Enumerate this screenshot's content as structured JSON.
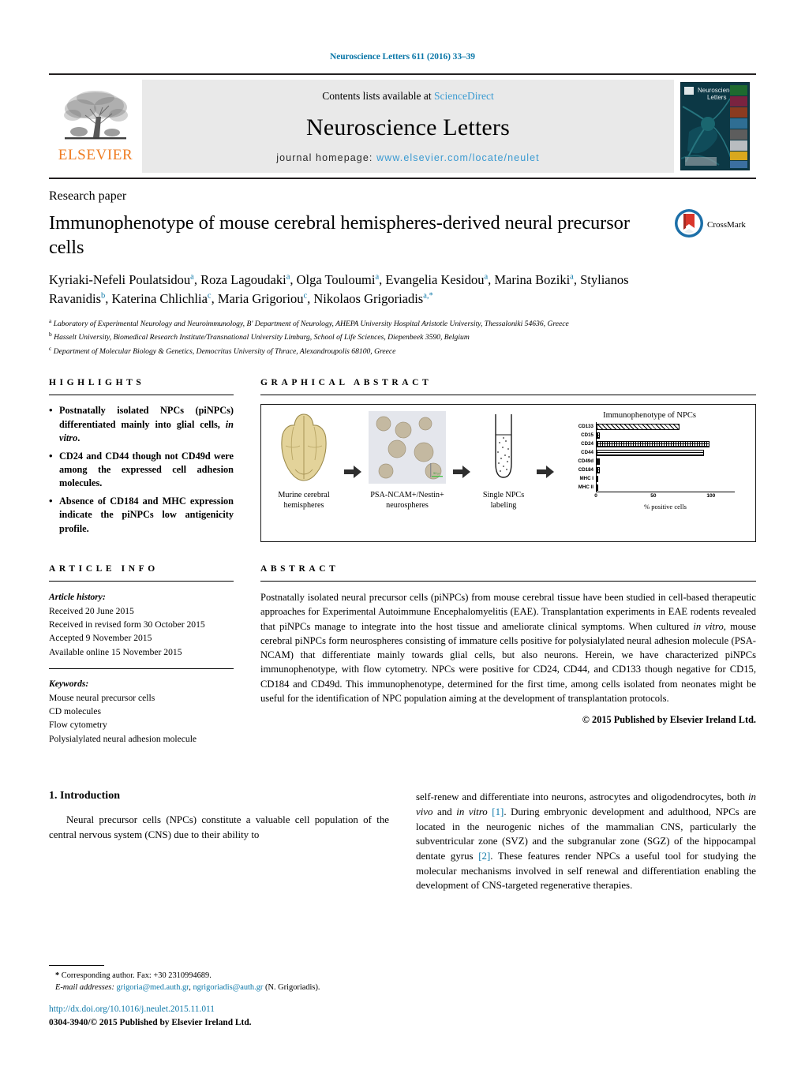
{
  "running_head": "Neuroscience Letters 611 (2016) 33–39",
  "masthead": {
    "publisher_name": "ELSEVIER",
    "contents_prefix": "Contents lists available at ",
    "contents_link": "ScienceDirect",
    "journal_title": "Neuroscience Letters",
    "homepage_prefix": "journal homepage: ",
    "homepage_url": "www.elsevier.com/locate/neulet",
    "cover_title_line1": "Neuroscience",
    "cover_title_line2": "Letters"
  },
  "article": {
    "doctype": "Research paper",
    "title": "Immunophenotype of mouse cerebral hemispheres-derived neural precursor cells",
    "authors_html": "Kyriaki-Nefeli Poulatsidou<sup>a</sup>, Roza Lagoudaki<sup>a</sup>, Olga Touloumi<sup>a</sup>, Evangelia Kesidou<sup>a</sup>, Marina Boziki<sup>a</sup>, Stylianos Ravanidis<sup>b</sup>, Katerina Chlichlia<sup>c</sup>, Maria Grigoriou<sup>c</sup>, Nikolaos Grigoriadis<sup>a,*</sup>",
    "crossmark_label": "CrossMark",
    "affiliations": [
      "Laboratory of Experimental Neurology and Neuroimmunology, B' Department of Neurology, AHEPA University Hospital Aristotle University, Thessaloniki 54636, Greece",
      "Hasselt University, Biomedical Research Institute/Transnational University Limburg, School of Life Sciences, Diepenbeek 3590, Belgium",
      "Department of Molecular Biology & Genetics, Democritus University of Thrace, Alexandroupolis 68100, Greece"
    ],
    "affiliation_marks": [
      "a",
      "b",
      "c"
    ]
  },
  "highlights": {
    "heading": "HIGHLIGHTS",
    "items_html": [
      "Postnatally isolated NPCs (piNPCs) differentiated mainly into glial cells, <i>in vitro</i>.",
      "CD24 and CD44 though not CD49d were among the expressed cell adhesion molecules.",
      "Absence of CD184 and MHC expression indicate the piNPCs low antigenicity profile."
    ]
  },
  "graphical_abstract": {
    "heading": "GRAPHICAL ABSTRACT",
    "steps": [
      {
        "caption": "Murine cerebral hemispheres",
        "icon": "mouse-brain-icon"
      },
      {
        "caption": "PSA-NCAM+/Nestin+ neurospheres",
        "icon": "neurosphere-micrograph"
      },
      {
        "caption": "Single NPCs labeling",
        "icon": "test-tube-icon"
      }
    ]
  },
  "chart_data": {
    "type": "bar",
    "orientation": "horizontal",
    "title": "Immunophenotype of NPCs",
    "xlabel": "% positive cells",
    "ylabel": "",
    "categories": [
      "CD133",
      "CD15",
      "CD24",
      "CD44",
      "CD49d",
      "CD184",
      "MHC I",
      "MHC II"
    ],
    "values": [
      72,
      3,
      98,
      93,
      3,
      3,
      0,
      1
    ],
    "xlim": [
      0,
      120
    ],
    "xticks": [
      0,
      50,
      100
    ],
    "xtick_labels": [
      "0",
      "50",
      "100"
    ],
    "grid": false,
    "legend": "none",
    "fills": [
      "hatch",
      "grid",
      "grid",
      "hlines",
      "solid",
      "grid",
      "solid",
      "solid"
    ]
  },
  "article_info": {
    "heading": "ARTICLE INFO",
    "history_label": "Article history:",
    "history": [
      "Received 20 June 2015",
      "Received in revised form 30 October 2015",
      "Accepted 9 November 2015",
      "Available online 15 November 2015"
    ],
    "keywords_label": "Keywords:",
    "keywords": [
      "Mouse neural precursor cells",
      "CD molecules",
      "Flow cytometry",
      "Polysialylated neural adhesion molecule"
    ]
  },
  "abstract": {
    "heading": "ABSTRACT",
    "text_html": "Postnatally isolated neural precursor cells (piNPCs) from mouse cerebral tissue have been studied in cell-based therapeutic approaches for Experimental Autoimmune Encephalomyelitis (EAE). Transplantation experiments in EAE rodents revealed that piNPCs manage to integrate into the host tissue and ameliorate clinical symptoms. When cultured <i>in vitro</i>, mouse cerebral piNPCs form neurospheres consisting of immature cells positive for polysialylated neural adhesion molecule (PSA-NCAM) that differentiate mainly towards glial cells, but also neurons. Herein, we have characterized piNPCs immunophenotype, with flow cytometry. NPCs were positive for CD24, CD44, and CD133 though negative for CD15, CD184 and CD49d. This immunophenotype, determined for the first time, among cells isolated from neonates might be useful for the identification of NPC population aiming at the development of transplantation protocols.",
    "copyright": "© 2015 Published by Elsevier Ireland Ltd."
  },
  "introduction": {
    "heading": "1.  Introduction",
    "col1_html": "Neural precursor cells (NPCs) constitute a valuable cell population of the central nervous system (CNS) due to their ability to",
    "col2_html": "self-renew and differentiate into neurons, astrocytes and oligodendrocytes, both <i>in vivo</i> and <i>in vitro</i> <span class=\"ref\">[1]</span>. During embryonic development and adulthood, NPCs are located in the neurogenic niches of the mammalian CNS, particularly the subventricular zone (SVZ) and the subgranular zone (SGZ) of the hippocampal dentate gyrus <span class=\"ref\">[2]</span>. These features render NPCs a useful tool for studying the molecular mechanisms involved in self renewal and differentiation enabling the development of CNS-targeted regenerative therapies."
  },
  "footer": {
    "corresponding_html": "<b>*</b> Corresponding author. Fax: +30 2310994689.",
    "email_label": "E-mail addresses:",
    "email1": "grigoria@med.auth.gr",
    "email2": "ngrigoriadis@auth.gr",
    "email_suffix": "(N. Grigoriadis).",
    "doi": "http://dx.doi.org/10.1016/j.neulet.2015.11.011",
    "issn": "0304-3940/© 2015 Published by Elsevier Ireland Ltd."
  },
  "colors": {
    "link": "#0b77a8",
    "sciencedirect": "#3a9ad1",
    "elsevier_orange": "#ef7c22",
    "band_gray": "#e9e9e9"
  }
}
